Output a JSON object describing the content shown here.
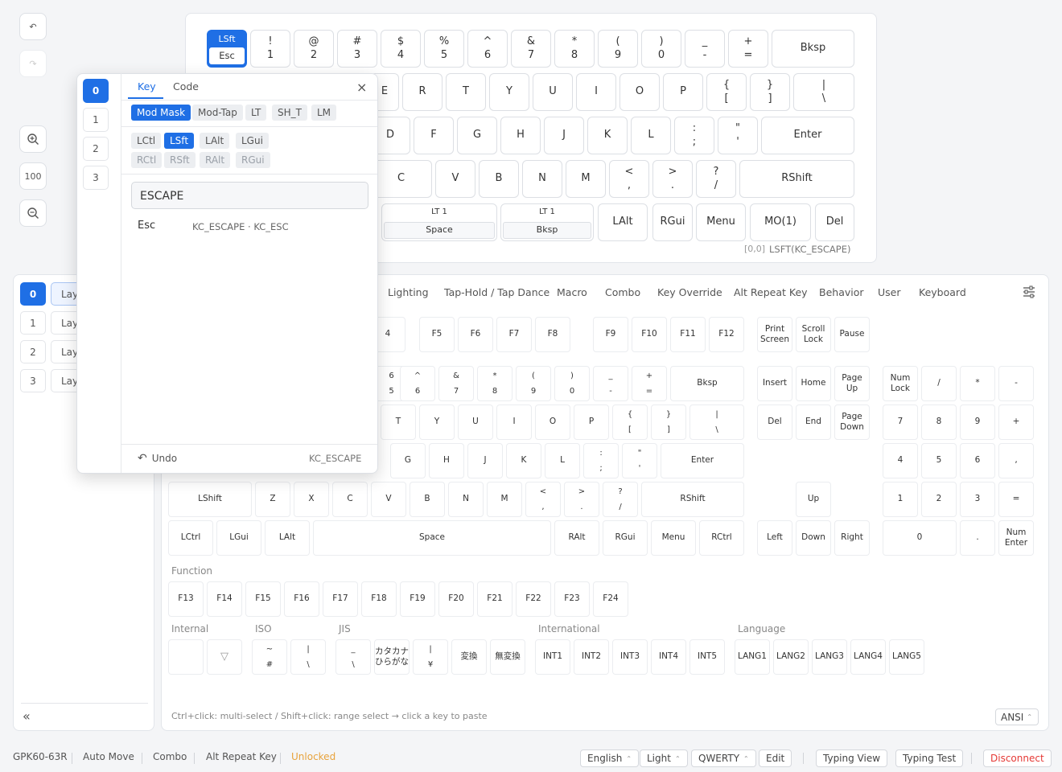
{
  "toolbar": {
    "zoom": "100"
  },
  "layers_left": {
    "numbers": [
      "0",
      "1",
      "2",
      "3"
    ],
    "labels": [
      "Lay",
      "Lay",
      "Lay",
      "Lay"
    ],
    "collapse": "«"
  },
  "editor": {
    "keys": [
      [
        "LSft",
        "Esc"
      ],
      [
        "!",
        "1"
      ],
      [
        "@",
        "2"
      ],
      [
        "#",
        "3"
      ],
      [
        "$",
        "4"
      ],
      [
        "%",
        "5"
      ],
      [
        "^",
        "6"
      ],
      [
        "&",
        "7"
      ],
      [
        "*",
        "8"
      ],
      [
        "(",
        "9"
      ],
      [
        ")",
        "0"
      ],
      [
        "_",
        "-"
      ],
      [
        "+",
        "="
      ],
      [
        "Bksp"
      ],
      [
        "E"
      ],
      [
        "R"
      ],
      [
        "T"
      ],
      [
        "Y"
      ],
      [
        "U"
      ],
      [
        "I"
      ],
      [
        "O"
      ],
      [
        "P"
      ],
      [
        "{",
        "["
      ],
      [
        "}",
        "]"
      ],
      [
        "|",
        "\\"
      ],
      [
        "D"
      ],
      [
        "F"
      ],
      [
        "G"
      ],
      [
        "H"
      ],
      [
        "J"
      ],
      [
        "K"
      ],
      [
        "L"
      ],
      [
        ":",
        ";"
      ],
      [
        "\"",
        "'"
      ],
      [
        "Enter"
      ],
      [
        "C"
      ],
      [
        "V"
      ],
      [
        "B"
      ],
      [
        "N"
      ],
      [
        "M"
      ],
      [
        "<",
        ","
      ],
      [
        ">",
        "."
      ],
      [
        "?",
        "/"
      ],
      [
        "RShift"
      ],
      [
        "LT 1",
        "Space"
      ],
      [
        "LT 1",
        "Bksp"
      ],
      [
        "LAlt"
      ],
      [
        "RGui"
      ],
      [
        "Menu"
      ],
      [
        "MO(1)"
      ],
      [
        "Del"
      ]
    ],
    "status_pos": "[0,0]",
    "status_code": "LSFT(KC_ESCAPE)"
  },
  "popup": {
    "layers": [
      "0",
      "1",
      "2",
      "3"
    ],
    "tabs": [
      "Key",
      "Code"
    ],
    "close": "×",
    "modes": [
      "Mod Mask",
      "Mod-Tap",
      "LT",
      "SH_T",
      "LM"
    ],
    "left_mods": [
      "LCtl",
      "LSft",
      "LAlt",
      "LGui"
    ],
    "right_mods": [
      "RCtl",
      "RSft",
      "RAlt",
      "RGui"
    ],
    "search_value": "ESCAPE",
    "result_label": "Esc",
    "result_codes": "KC_ESCAPE · KC_ESC",
    "undo": "Undo",
    "current": "KC_ESCAPE"
  },
  "categories": [
    "Lighting",
    "Tap-Hold / Tap Dance",
    "Macro",
    "Combo",
    "Key Override",
    "Alt Repeat Key",
    "Behavior",
    "User",
    "Keyboard"
  ],
  "board_keys": [
    [
      "4"
    ],
    [
      "F5"
    ],
    [
      "F6"
    ],
    [
      "F7"
    ],
    [
      "F8"
    ],
    [
      "F9"
    ],
    [
      "F10"
    ],
    [
      "F11"
    ],
    [
      "F12"
    ],
    [
      "Print",
      "Screen"
    ],
    [
      "Scroll",
      "Lock"
    ],
    [
      "Pause"
    ],
    [
      "6",
      "5"
    ],
    [
      "^",
      "6"
    ],
    [
      "&",
      "7"
    ],
    [
      "*",
      "8"
    ],
    [
      "(",
      "9"
    ],
    [
      ")",
      "0"
    ],
    [
      "_",
      "-"
    ],
    [
      "+",
      "="
    ],
    [
      "Bksp"
    ],
    [
      "Insert"
    ],
    [
      "Home"
    ],
    [
      "Page",
      "Up"
    ],
    [
      "Num",
      "Lock"
    ],
    [
      "/"
    ],
    [
      "*"
    ],
    [
      "-"
    ],
    [
      "T"
    ],
    [
      "Y"
    ],
    [
      "U"
    ],
    [
      "I"
    ],
    [
      "O"
    ],
    [
      "P"
    ],
    [
      "{",
      "["
    ],
    [
      "}",
      "]"
    ],
    [
      "|",
      "\\"
    ],
    [
      "Del"
    ],
    [
      "End"
    ],
    [
      "Page",
      "Down"
    ],
    [
      "7"
    ],
    [
      "8"
    ],
    [
      "9"
    ],
    [
      "+"
    ],
    [
      "G"
    ],
    [
      "H"
    ],
    [
      "J"
    ],
    [
      "K"
    ],
    [
      "L"
    ],
    [
      ":",
      ";"
    ],
    [
      "\"",
      "'"
    ],
    [
      "Enter"
    ],
    [
      "4"
    ],
    [
      "5"
    ],
    [
      "6"
    ],
    [
      ","
    ],
    [
      "LShift"
    ],
    [
      "Z"
    ],
    [
      "X"
    ],
    [
      "C"
    ],
    [
      "V"
    ],
    [
      "B"
    ],
    [
      "N"
    ],
    [
      "M"
    ],
    [
      "<",
      ","
    ],
    [
      ">",
      "."
    ],
    [
      "?",
      "/"
    ],
    [
      "RShift"
    ],
    [
      "Up"
    ],
    [
      "1"
    ],
    [
      "2"
    ],
    [
      "3"
    ],
    [
      "="
    ],
    [
      "LCtrl"
    ],
    [
      "LGui"
    ],
    [
      "LAlt"
    ],
    [
      "Space"
    ],
    [
      "RAlt"
    ],
    [
      "RGui"
    ],
    [
      "Menu"
    ],
    [
      "RCtrl"
    ],
    [
      "Left"
    ],
    [
      "Down"
    ],
    [
      "Right"
    ],
    [
      "0"
    ],
    [
      "."
    ],
    [
      "Num",
      "Enter"
    ],
    [
      "F13"
    ],
    [
      "F14"
    ],
    [
      "F15"
    ],
    [
      "F16"
    ],
    [
      "F17"
    ],
    [
      "F18"
    ],
    [
      "F19"
    ],
    [
      "F20"
    ],
    [
      "F21"
    ],
    [
      "F22"
    ],
    [
      "F23"
    ],
    [
      "F24"
    ],
    [
      ""
    ],
    [
      "▽"
    ],
    [
      "~",
      "#"
    ],
    [
      "|",
      "\\"
    ],
    [
      "_",
      "\\"
    ],
    [
      "カタカナ",
      "ひらがな"
    ],
    [
      "|",
      "¥"
    ],
    [
      "変換"
    ],
    [
      "無変換"
    ],
    [
      "INT1"
    ],
    [
      "INT2"
    ],
    [
      "INT3"
    ],
    [
      "INT4"
    ],
    [
      "INT5"
    ],
    [
      "LANG1"
    ],
    [
      "LANG2"
    ],
    [
      "LANG3"
    ],
    [
      "LANG4"
    ],
    [
      "LANG5"
    ]
  ],
  "sections": {
    "function": "Function",
    "internal": "Internal",
    "iso": "ISO",
    "jis": "JIS",
    "international": "International",
    "language": "Language"
  },
  "hint": "Ctrl+click: multi-select / Shift+click: range select → click a key to paste",
  "layout_select": "ANSI",
  "statusbar": {
    "device": "GPK60-63R",
    "auto_move": "Auto Move",
    "combo": "Combo",
    "alt_repeat": "Alt Repeat Key",
    "unlocked": "Unlocked",
    "language": "English",
    "theme": "Light",
    "keymap": "QWERTY",
    "edit": "Edit",
    "typing_view": "Typing View",
    "typing_test": "Typing Test",
    "disconnect": "Disconnect"
  },
  "colors": {
    "accent": "#1f6fe5",
    "unlocked": "#e8a33c",
    "disconnect": "#e53935"
  }
}
